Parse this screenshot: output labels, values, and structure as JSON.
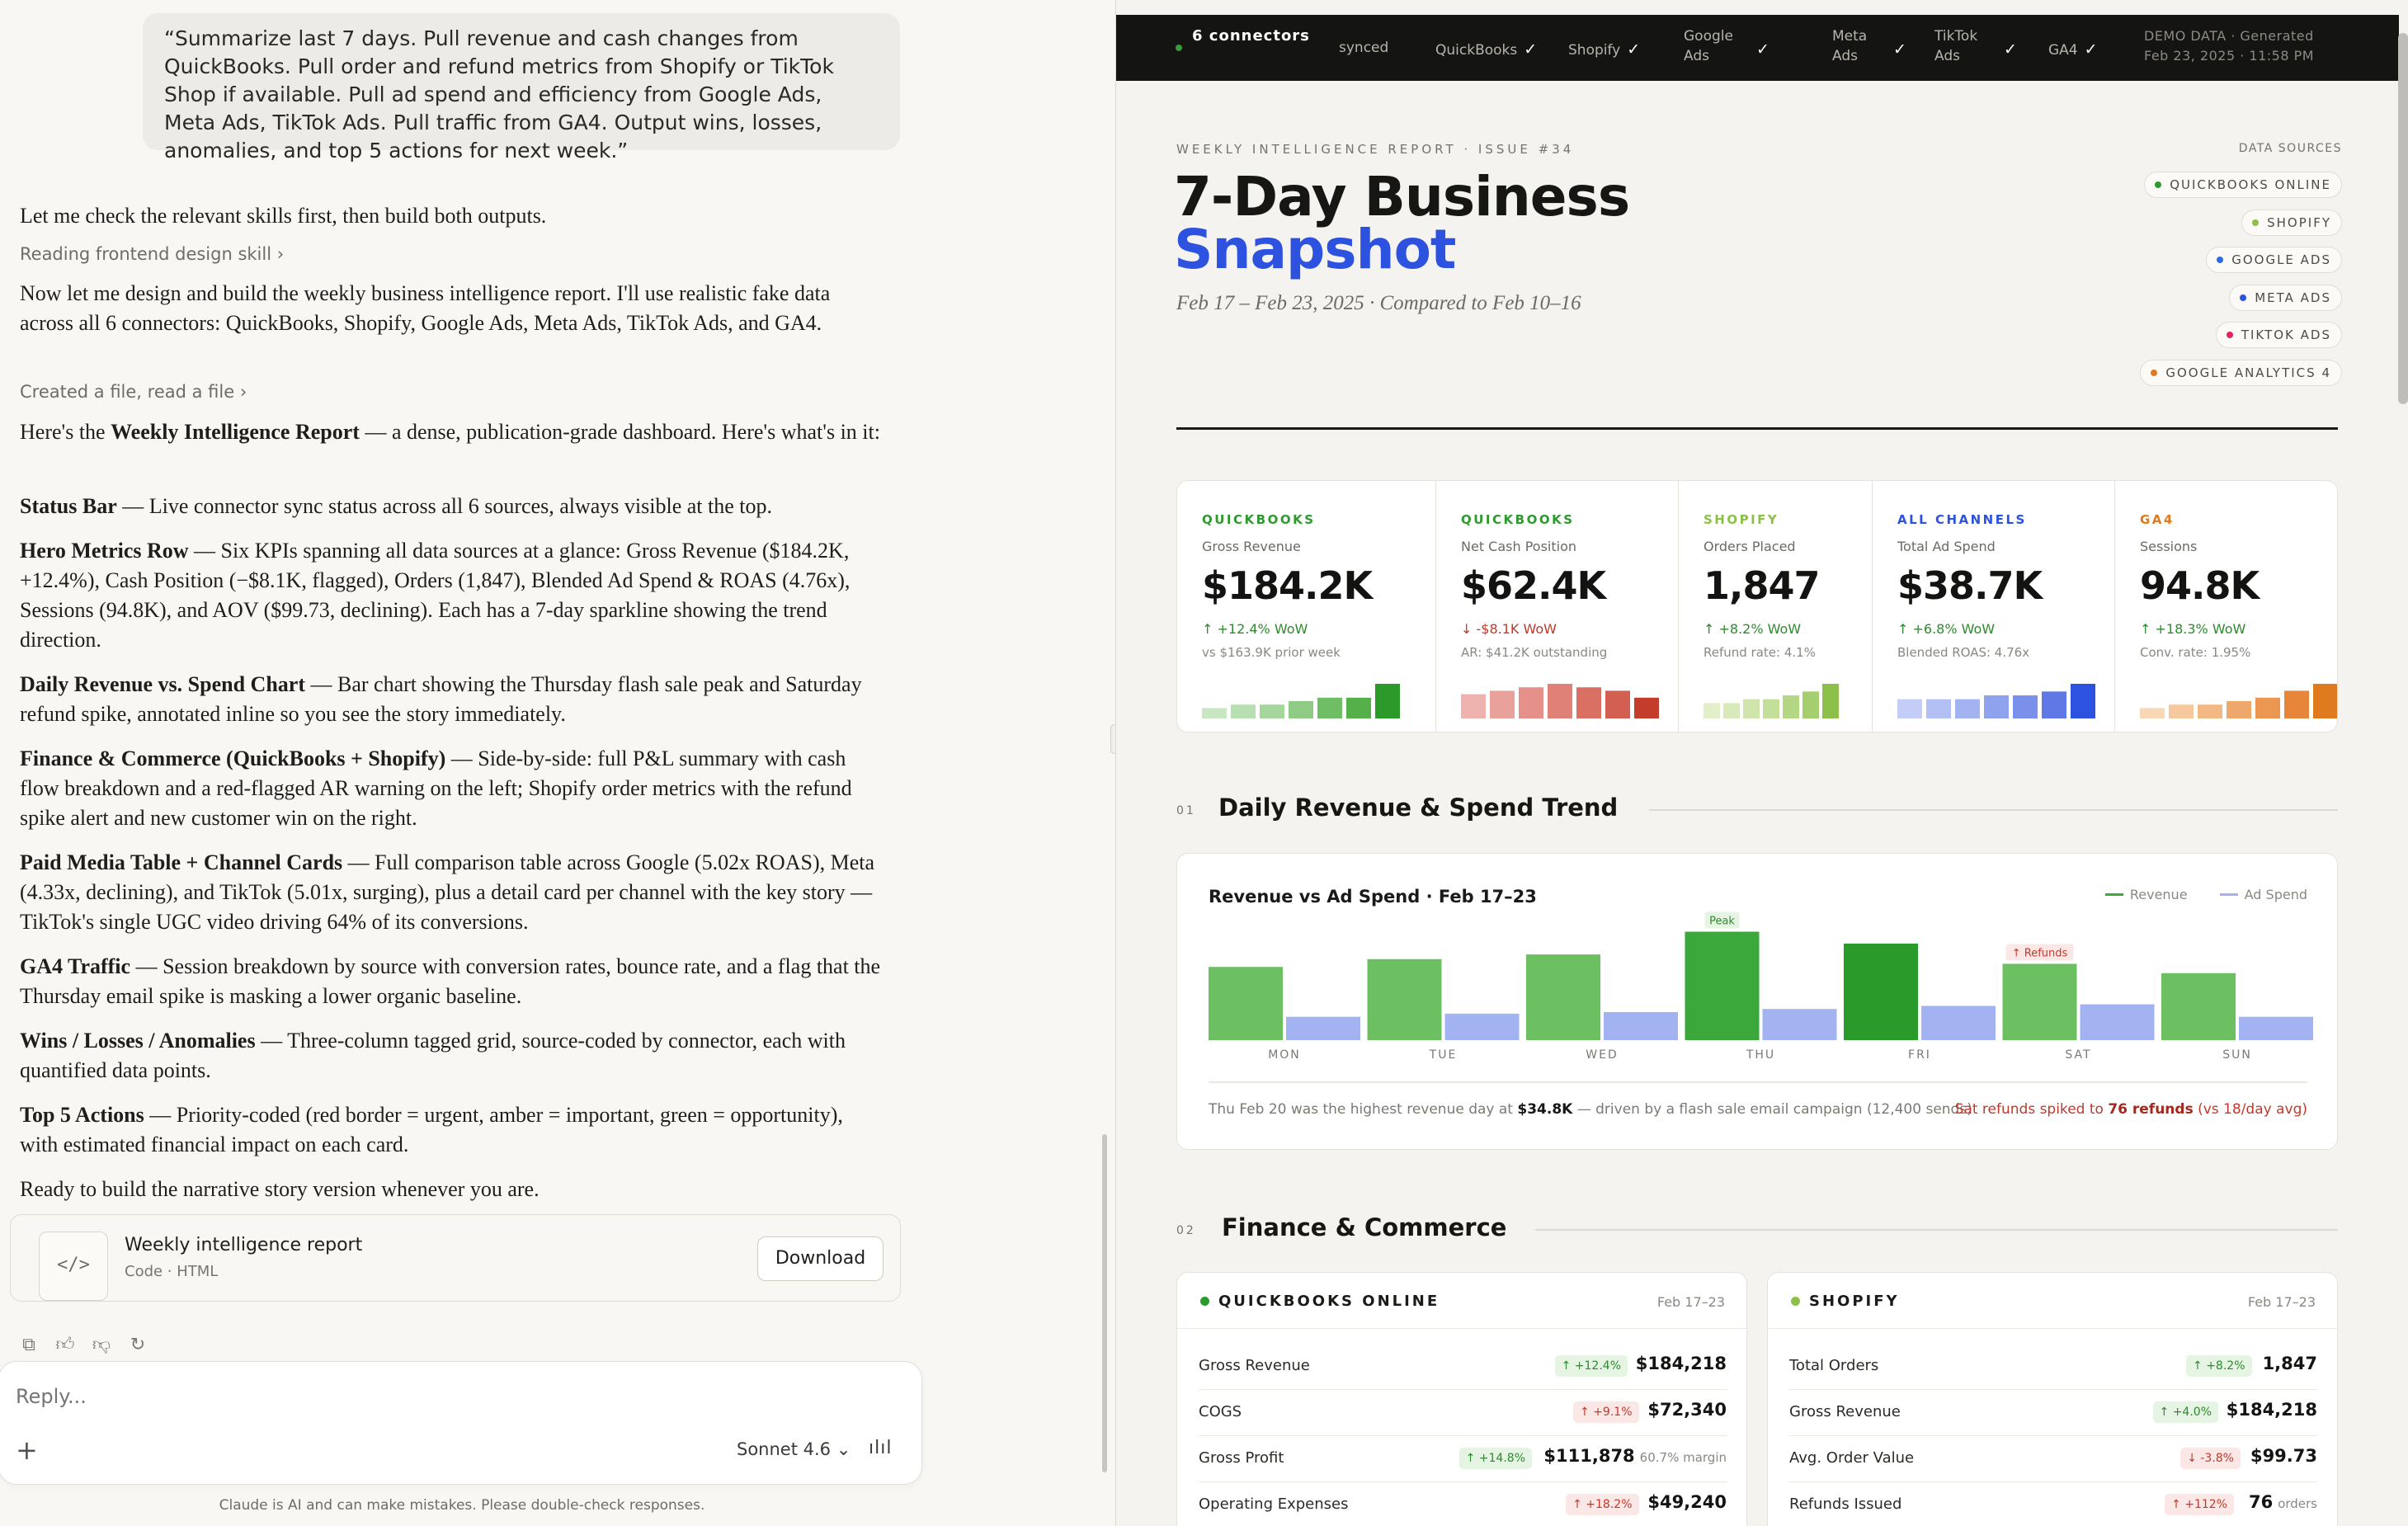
{
  "chat": {
    "user_prompt": "“Summarize last 7 days. Pull revenue and cash changes from QuickBooks. Pull order and refund metrics from Shopify or TikTok Shop if available. Pull ad spend and efficiency from Google Ads, Meta Ads, TikTok Ads. Pull traffic from GA4. Output wins, losses, anomalies, and top 5 actions for next week.”",
    "para1": "Let me check the relevant skills first, then build both outputs.",
    "link1": "Reading frontend design skill",
    "para2": "Now let me design and build the weekly business intelligence report. I'll use realistic fake data across all 6 connectors: QuickBooks, Shopify, Google Ads, Meta Ads, TikTok Ads, and GA4.",
    "link2": "Created a file, read a file",
    "para3_pre": "Here's the ",
    "para3_bold": "Weekly Intelligence Report",
    "para3_post": " — a dense, publication-grade dashboard. Here's what's in it:",
    "sections": [
      {
        "title": "Status Bar",
        "body": " — Live connector sync status across all 6 sources, always visible at the top."
      },
      {
        "title": "Hero Metrics Row",
        "body": " — Six KPIs spanning all data sources at a glance: Gross Revenue ($184.2K, +12.4%), Cash Position (−$8.1K, flagged), Orders (1,847), Blended Ad Spend & ROAS (4.76x), Sessions (94.8K), and AOV ($99.73, declining). Each has a 7-day sparkline showing the trend direction."
      },
      {
        "title": "Daily Revenue vs. Spend Chart",
        "body": " — Bar chart showing the Thursday flash sale peak and Saturday refund spike, annotated inline so you see the story immediately."
      },
      {
        "title": "Finance & Commerce (QuickBooks + Shopify)",
        "body": " — Side-by-side: full P&L summary with cash flow breakdown and a red-flagged AR warning on the left; Shopify order metrics with the refund spike alert and new customer win on the right."
      },
      {
        "title": "Paid Media Table + Channel Cards",
        "body": " — Full comparison table across Google (5.02x ROAS), Meta (4.33x, declining), and TikTok (5.01x, surging), plus a detail card per channel with the key story — TikTok's single UGC video driving 64% of its conversions."
      },
      {
        "title": "GA4 Traffic",
        "body": " — Session breakdown by source with conversion rates, bounce rate, and a flag that the Thursday email spike is masking a lower organic baseline."
      },
      {
        "title": "Wins / Losses / Anomalies",
        "body": " — Three-column tagged grid, source-coded by connector, each with quantified data points."
      },
      {
        "title": "Top 5 Actions",
        "body": " — Priority-coded (red border = urgent, amber = important, green = opportunity), with estimated financial impact on each card."
      }
    ],
    "closing": "Ready to build the narrative story version whenever you are.",
    "artifact": {
      "title": "Weekly intelligence report",
      "subtitle": "Code · HTML",
      "icon": "</>",
      "download": "Download"
    },
    "reply_placeholder": "Reply...",
    "model": "Sonnet 4.6",
    "disclaimer": "Claude is AI and can make mistakes. Please double-check responses."
  },
  "report": {
    "topbar": {
      "connectors_count": "6 connectors",
      "synced": "synced",
      "items": [
        {
          "label": "QuickBooks",
          "check": "✓"
        },
        {
          "label": "Shopify",
          "check": "✓"
        },
        {
          "label": "Google Ads",
          "check": "✓"
        },
        {
          "label": "Meta Ads",
          "check": "✓"
        },
        {
          "label": "TikTok Ads",
          "check": "✓"
        },
        {
          "label": "GA4",
          "check": "✓"
        }
      ],
      "demo_line1": "DEMO DATA · Generated",
      "demo_line2": "Feb 23, 2025 · 11:58 PM"
    },
    "eyebrow": "WEEKLY INTELLIGENCE REPORT · ISSUE #34",
    "title_line1": "7-Day Business",
    "title_line2": "Snapshot",
    "date_range": "Feb 17 – Feb 23, 2025 · Compared to Feb 10–16",
    "data_sources_title": "DATA SOURCES",
    "data_sources": [
      {
        "label": "QUICKBOOKS ONLINE",
        "color": "#2e9a2e"
      },
      {
        "label": "SHOPIFY",
        "color": "#8cc04a"
      },
      {
        "label": "GOOGLE ADS",
        "color": "#2d6ce0"
      },
      {
        "label": "META ADS",
        "color": "#2d52e0"
      },
      {
        "label": "TIKTOK ADS",
        "color": "#e0245e"
      },
      {
        "label": "GOOGLE ANALYTICS 4",
        "color": "#e07a1f"
      }
    ],
    "kpis": [
      {
        "source": "QUICKBOOKS",
        "src_color": "#2e9a2e",
        "label": "Gross Revenue",
        "value": "$184.2K",
        "change": "↑ +12.4% WoW",
        "change_color": "#2e8a2e",
        "sub": "vs $163.9K prior week",
        "spark": [
          3,
          4,
          4,
          5,
          6,
          6,
          10
        ],
        "spark_colors": [
          "#c9e6c3",
          "#b8dfb1",
          "#a5d69c",
          "#8fcb85",
          "#6fbd64",
          "#55b04a",
          "#2b9a2b"
        ]
      },
      {
        "source": "QUICKBOOKS",
        "src_color": "#2e9a2e",
        "label": "Net Cash Position",
        "value": "$62.4K",
        "change": "↓ -$8.1K WoW",
        "change_color": "#c0392b",
        "sub": "AR: $41.2K outstanding",
        "spark": [
          7,
          8,
          9,
          10,
          9,
          8,
          6
        ],
        "spark_colors": [
          "#eeb3ae",
          "#e9a29b",
          "#e59189",
          "#e08177",
          "#da7064",
          "#d35f52",
          "#c43c2c"
        ]
      },
      {
        "source": "SHOPIFY",
        "src_color": "#8cc04a",
        "label": "Orders Placed",
        "value": "1,847",
        "change": "↑ +8.2% WoW",
        "change_color": "#2e8a2e",
        "sub": "Refund rate: 4.1%",
        "spark": [
          4,
          4,
          5,
          5,
          6,
          7,
          9
        ],
        "spark_colors": [
          "#e2efc9",
          "#d8eaba",
          "#cfe5ac",
          "#c3df9a",
          "#b4d784",
          "#a5cf6e",
          "#8cc04a"
        ]
      },
      {
        "source": "ALL CHANNELS",
        "src_color": "#2d52e0",
        "label": "Total Ad Spend",
        "value": "$38.7K",
        "change": "↑ +6.8% WoW",
        "change_color": "#2e8a2e",
        "sub": "Blended ROAS: 4.76x",
        "spark": [
          5,
          5,
          5,
          6,
          6,
          7,
          9
        ],
        "spark_colors": [
          "#c3cdf6",
          "#b3c0f4",
          "#a3b3f2",
          "#8fa2ee",
          "#7b90ea",
          "#6078e5",
          "#2d52e0"
        ]
      },
      {
        "source": "GA4",
        "src_color": "#e07a1f",
        "label": "Sessions",
        "value": "94.8K",
        "change": "↑ +18.3% WoW",
        "change_color": "#2e8a2e",
        "sub": "Conv. rate: 1.95%",
        "spark": [
          3,
          4,
          4,
          5,
          6,
          8,
          10
        ],
        "spark_colors": [
          "#f8d7b6",
          "#f5c89e",
          "#f2b985",
          "#efa86b",
          "#eb9752",
          "#e7863a",
          "#e07a1f"
        ]
      }
    ],
    "section1": {
      "num": "01",
      "title": "Daily Revenue & Spend Trend"
    },
    "chart_data": {
      "type": "bar",
      "title": "Revenue vs Ad Spend · Feb 17–23",
      "categories": [
        "MON",
        "TUE",
        "WED",
        "THU",
        "FRI",
        "SAT",
        "SUN"
      ],
      "series": [
        {
          "name": "Revenue",
          "color": "#6cc062",
          "values": [
            23.5,
            26.0,
            27.5,
            34.8,
            31.0,
            24.5,
            21.5
          ]
        },
        {
          "name": "Ad Spend",
          "color": "#a3b3f2",
          "values": [
            7.5,
            8.5,
            9.0,
            10.0,
            11.0,
            11.5,
            7.5
          ]
        }
      ],
      "highlight_colors": {
        "THU": "#3aa83a",
        "FRI": "#2a9a2a"
      },
      "ylim": [
        0,
        36
      ],
      "annotations": [
        {
          "category": "THU",
          "text": "Peak",
          "color": "#2e8a2e"
        },
        {
          "category": "SAT",
          "text": "↑ Refunds",
          "color": "#c0392b"
        }
      ],
      "xlabel": "",
      "ylabel": "",
      "grid": false,
      "legend": "top-right"
    },
    "chart_note_left_pre": "Thu Feb 20 was the highest revenue day at ",
    "chart_note_left_bold": "$34.8K",
    "chart_note_left_post": " — driven by a flash sale email campaign (12,400 sends)",
    "chart_note_right_pre": "Sat refunds spiked to ",
    "chart_note_right_bold": "76 refunds",
    "chart_note_right_post": " (vs 18/day avg)",
    "section2": {
      "num": "02",
      "title": "Finance & Commerce"
    },
    "quickbooks": {
      "name": "QUICKBOOKS ONLINE",
      "period": "Feb 17–23",
      "dot": "#2e9a2e",
      "rows": [
        {
          "label": "Gross Revenue",
          "badge": "↑ +12.4%",
          "badge_kind": "up-good",
          "value": "$184,218",
          "note": ""
        },
        {
          "label": "COGS",
          "badge": "↑ +9.1%",
          "badge_kind": "up-bad",
          "value": "$72,340",
          "note": ""
        },
        {
          "label": "Gross Profit",
          "badge": "↑ +14.8%",
          "badge_kind": "up-good",
          "value": "$111,878",
          "note": "60.7% margin"
        },
        {
          "label": "Operating Expenses",
          "badge": "↑ +18.2%",
          "badge_kind": "up-bad",
          "value": "$49,240",
          "note": ""
        }
      ]
    },
    "shopify": {
      "name": "SHOPIFY",
      "period": "Feb 17–23",
      "dot": "#8cc04a",
      "rows": [
        {
          "label": "Total Orders",
          "badge": "↑ +8.2%",
          "badge_kind": "up-good",
          "value": "1,847",
          "note": ""
        },
        {
          "label": "Gross Revenue",
          "badge": "↑ +4.0%",
          "badge_kind": "up-good",
          "value": "$184,218",
          "note": ""
        },
        {
          "label": "Avg. Order Value",
          "badge": "↓ -3.8%",
          "badge_kind": "down-bad",
          "value": "$99.73",
          "note": ""
        },
        {
          "label": "Refunds Issued",
          "badge": "↑ +112%",
          "badge_kind": "up-bad",
          "value": "76",
          "note": "orders"
        }
      ]
    }
  }
}
